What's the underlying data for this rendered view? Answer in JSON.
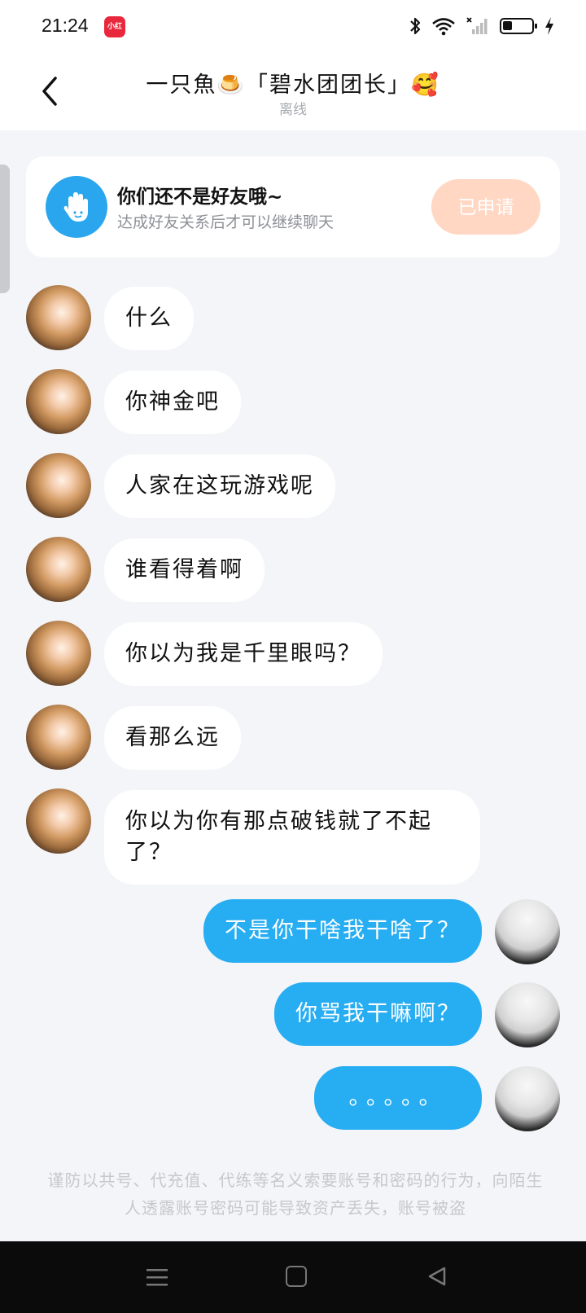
{
  "status_bar": {
    "time": "21:24",
    "app_badge": "小红书",
    "icons": [
      "bluetooth-icon",
      "wifi-icon",
      "signal-icon",
      "battery-icon",
      "charging-icon"
    ]
  },
  "header": {
    "title": "一只魚🍮「碧水团团长」🥰",
    "status": "离线",
    "back_icon": "chevron-left-icon"
  },
  "friend_card": {
    "title": "你们还不是好友哦~",
    "subtitle": "达成好友关系后才可以继续聊天",
    "button_label": "已申请",
    "icon": "hand-wave-icon"
  },
  "messages": [
    {
      "side": "left",
      "text": "什么"
    },
    {
      "side": "left",
      "text": "你神金吧"
    },
    {
      "side": "left",
      "text": "人家在这玩游戏呢"
    },
    {
      "side": "left",
      "text": "谁看得着啊"
    },
    {
      "side": "left",
      "text": "你以为我是千里眼吗？"
    },
    {
      "side": "left",
      "text": "看那么远"
    },
    {
      "side": "left",
      "text": "你以为你有那点破钱就了不起了？"
    },
    {
      "side": "right",
      "text": "不是你干啥我干啥了？"
    },
    {
      "side": "right",
      "text": "你骂我干嘛啊？"
    },
    {
      "side": "right",
      "text": "。。。。。"
    }
  ],
  "notice": "谨防以共号、代充值、代练等名义索要账号和密码的行为，向陌生人透露账号密码可能导致资产丢失，账号被盗",
  "nav_bar": {
    "icons": [
      "menu-icon",
      "home-icon",
      "back-icon"
    ]
  },
  "colors": {
    "my_bubble": "#27adf2",
    "applied_button": "#ffd7c3",
    "background": "#f3f5f8",
    "hand_icon_bg": "#2aa6ee"
  }
}
